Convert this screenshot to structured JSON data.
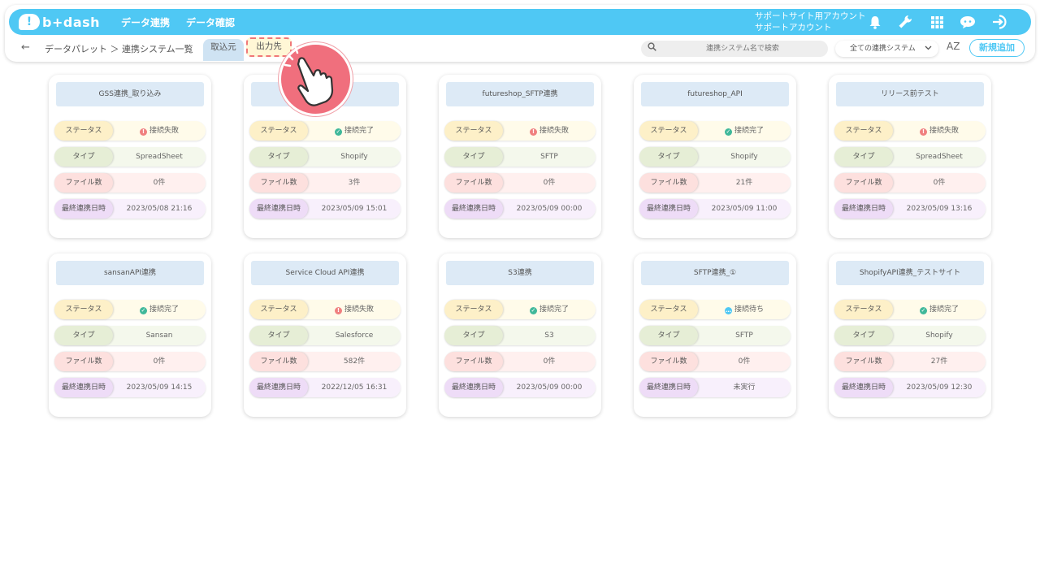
{
  "header": {
    "logo_mark": "!",
    "logo_text": "b+dash",
    "nav": [
      "データ連携",
      "データ確認"
    ],
    "account_line1": "サポートサイト用アカウント",
    "account_line2": "サポートアカウント"
  },
  "subbar": {
    "back_icon": "←",
    "breadcrumb": "データパレット ＞ 連携システム一覧",
    "tab_import": "取込元",
    "tab_export": "出力先",
    "search_placeholder": "連携システム名で検索",
    "filter_value": "全ての連携システム",
    "sort_label": "AZ",
    "add_button": "新規追加"
  },
  "labels": {
    "status": "ステータス",
    "type": "タイプ",
    "files": "ファイル数",
    "last_sync": "最終連携日時"
  },
  "status_colors": {
    "error": "#f08080",
    "ok": "#3fb89a",
    "waiting": "#4fc8f4"
  },
  "cards": [
    {
      "title": "GSS連携_取り込み",
      "status": "接続失敗",
      "status_kind": "error",
      "type": "SpreadSheet",
      "files": "0件",
      "last_sync": "2023/05/08 21:16"
    },
    {
      "title": "イト",
      "status": "接続完了",
      "status_kind": "ok",
      "type": "Shopify",
      "files": "3件",
      "last_sync": "2023/05/09 15:01"
    },
    {
      "title": "futureshop_SFTP連携",
      "status": "接続失敗",
      "status_kind": "error",
      "type": "SFTP",
      "files": "0件",
      "last_sync": "2023/05/09 00:00"
    },
    {
      "title": "futureshop_API",
      "status": "接続完了",
      "status_kind": "ok",
      "type": "Shopify",
      "files": "21件",
      "last_sync": "2023/05/09 11:00"
    },
    {
      "title": "リリース前テスト",
      "status": "接続失敗",
      "status_kind": "error",
      "type": "SpreadSheet",
      "files": "0件",
      "last_sync": "2023/05/09 13:16"
    },
    {
      "title": "sansanAPI連携",
      "status": "接続完了",
      "status_kind": "ok",
      "type": "Sansan",
      "files": "0件",
      "last_sync": "2023/05/09 14:15"
    },
    {
      "title": "Service Cloud API連携",
      "status": "接続失敗",
      "status_kind": "error",
      "type": "Salesforce",
      "files": "582件",
      "last_sync": "2022/12/05 16:31"
    },
    {
      "title": "S3連携",
      "status": "接続完了",
      "status_kind": "ok",
      "type": "S3",
      "files": "0件",
      "last_sync": "2023/05/09 00:00"
    },
    {
      "title": "SFTP連携_①",
      "status": "接続待ち",
      "status_kind": "waiting",
      "type": "SFTP",
      "files": "0件",
      "last_sync": "未実行"
    },
    {
      "title": "ShopifyAPI連携_テストサイト",
      "status": "接続完了",
      "status_kind": "ok",
      "type": "Shopify",
      "files": "27件",
      "last_sync": "2023/05/09 12:30"
    }
  ],
  "icons": [
    "bell-icon",
    "wrench-icon",
    "grid-icon",
    "chat-icon",
    "logout-icon",
    "search-icon",
    "chevron-down-icon",
    "sort-az-icon",
    "pointing-hand-icon"
  ]
}
